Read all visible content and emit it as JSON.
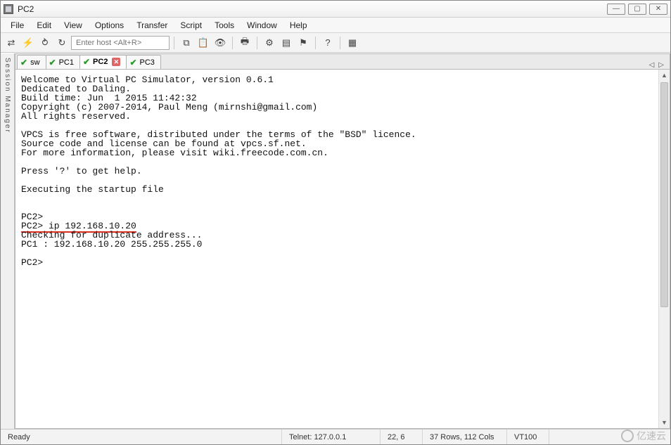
{
  "window": {
    "title": "PC2"
  },
  "menus": {
    "file": "File",
    "edit": "Edit",
    "view": "View",
    "options": "Options",
    "transfer": "Transfer",
    "script": "Script",
    "tools": "Tools",
    "window": "Window",
    "help": "Help"
  },
  "toolbar": {
    "host_placeholder": "Enter host <Alt+R>",
    "icons": {
      "reconnect": "reconnect-icon",
      "quick": "bolt-icon",
      "disc": "disconnect-icon",
      "recon2": "reconnect2-icon",
      "copy": "copy-icon",
      "paste": "paste-icon",
      "find": "find-icon",
      "print": "print-icon",
      "settings": "gear-icon",
      "props": "props-icon",
      "mark": "mark-icon",
      "help": "help-icon",
      "misc": "misc-icon"
    }
  },
  "side": {
    "label": "Session Manager"
  },
  "tabs": [
    {
      "label": "sw",
      "active": false,
      "closeable": false
    },
    {
      "label": "PC1",
      "active": false,
      "closeable": false
    },
    {
      "label": "PC2",
      "active": true,
      "closeable": true
    },
    {
      "label": "PC3",
      "active": false,
      "closeable": false
    }
  ],
  "terminal": {
    "lines": [
      "Welcome to Virtual PC Simulator, version 0.6.1",
      "Dedicated to Daling.",
      "Build time: Jun  1 2015 11:42:32",
      "Copyright (c) 2007-2014, Paul Meng (mirnshi@gmail.com)",
      "All rights reserved.",
      "",
      "VPCS is free software, distributed under the terms of the \"BSD\" licence.",
      "Source code and license can be found at vpcs.sf.net.",
      "For more information, please visit wiki.freecode.com.cn.",
      "",
      "Press '?' to get help.",
      "",
      "Executing the startup file",
      "",
      "",
      "PC2>"
    ],
    "underlined_prefix": "PC2> ",
    "underlined_cmd": "ip 192.168.10.20",
    "after_underline": [
      "Checking for duplicate address...",
      "PC1 : 192.168.10.20 255.255.255.0",
      "",
      "PC2> "
    ]
  },
  "status": {
    "ready": "Ready",
    "conn": "Telnet: 127.0.0.1",
    "cursor": "22,  6",
    "size": "37 Rows, 112 Cols",
    "term": "VT100"
  },
  "watermark": {
    "text": "亿速云"
  }
}
